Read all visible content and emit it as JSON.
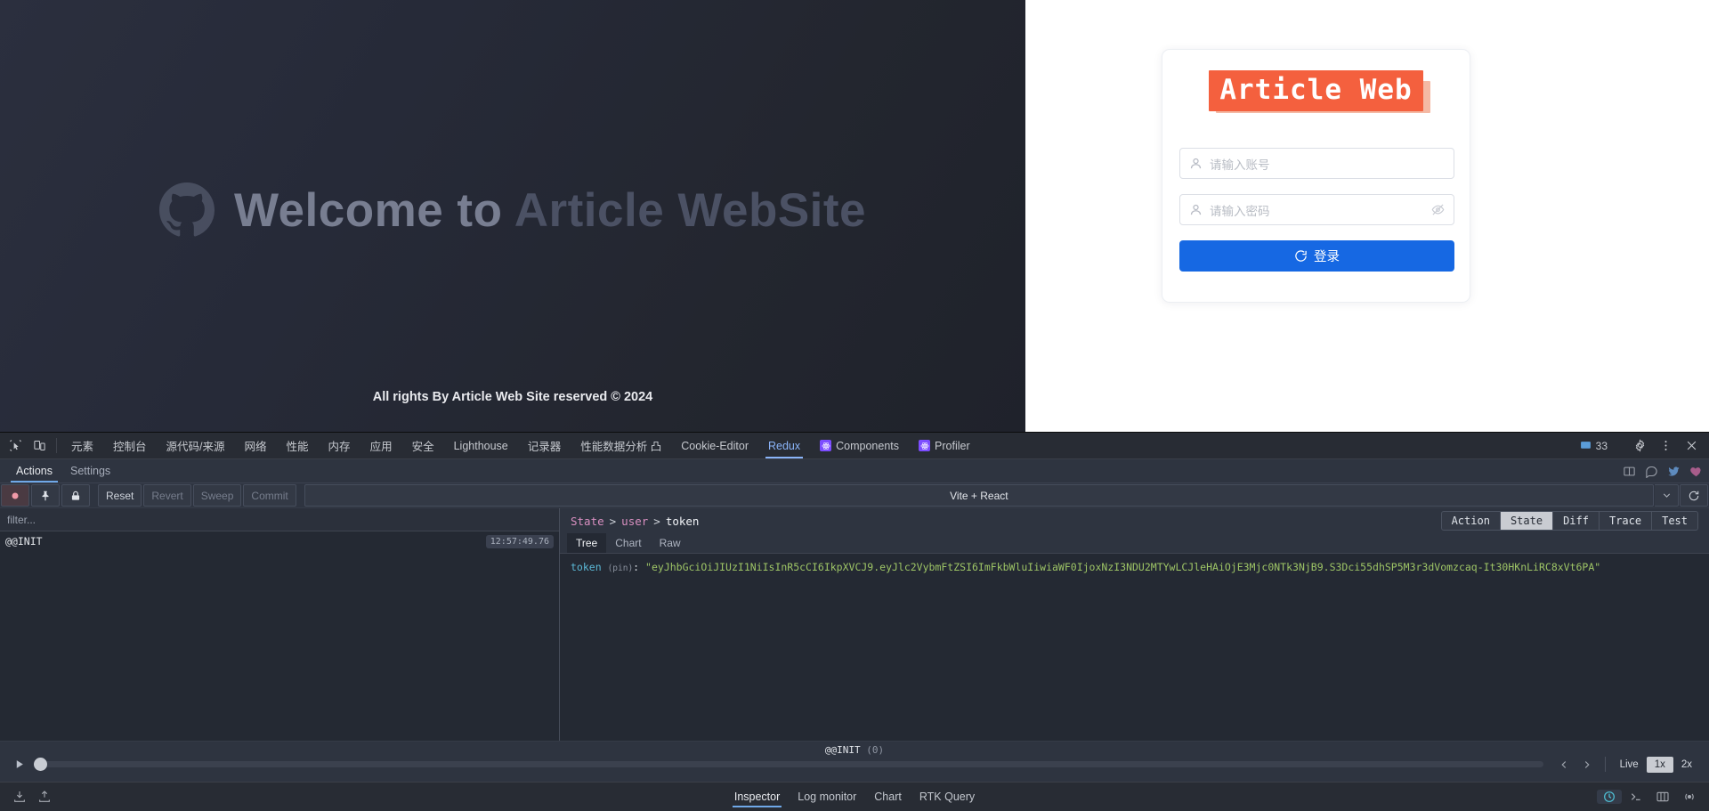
{
  "site": {
    "hero_title_part1": "Welcome to ",
    "hero_title_part2": "Article WebSite",
    "hero_title_full": "Welcome to Article WebSite",
    "github_icon": "github-icon",
    "footer": "All rights By Article Web Site reserved © 2024"
  },
  "login": {
    "brand": "Article Web",
    "username_placeholder": "请输入账号",
    "password_placeholder": "请输入密码",
    "user_icon": "user-icon",
    "eye_icon": "eye-off-icon",
    "submit_label": "登录",
    "submit_icon": "login-icon",
    "accent_color": "#1668e3",
    "brand_color": "#f4603e"
  },
  "devtools": {
    "inspect_icon": "inspect-element-icon",
    "device_icon": "device-toolbar-icon",
    "tabs": [
      {
        "label": "元素",
        "active": false,
        "icon": null
      },
      {
        "label": "控制台",
        "active": false,
        "icon": null
      },
      {
        "label": "源代码/来源",
        "active": false,
        "icon": null
      },
      {
        "label": "网络",
        "active": false,
        "icon": null
      },
      {
        "label": "性能",
        "active": false,
        "icon": null
      },
      {
        "label": "内存",
        "active": false,
        "icon": null
      },
      {
        "label": "应用",
        "active": false,
        "icon": null
      },
      {
        "label": "安全",
        "active": false,
        "icon": null
      },
      {
        "label": "Lighthouse",
        "active": false,
        "icon": null
      },
      {
        "label": "记录器",
        "active": false,
        "icon": null
      },
      {
        "label": "性能数据分析 凸",
        "active": false,
        "icon": null
      },
      {
        "label": "Cookie-Editor",
        "active": false,
        "icon": null
      },
      {
        "label": "Redux",
        "active": true,
        "icon": null
      },
      {
        "label": "Components",
        "active": false,
        "icon": "react-icon"
      },
      {
        "label": "Profiler",
        "active": false,
        "icon": "react-icon"
      }
    ],
    "message_count": "33",
    "message_icon": "console-message-icon",
    "settings_icon": "gear-icon",
    "more_icon": "more-vertical-icon",
    "close_icon": "close-icon"
  },
  "redux": {
    "panel_tabs": [
      {
        "label": "Actions",
        "active": true
      },
      {
        "label": "Settings",
        "active": false
      }
    ],
    "panel_tools": [
      "split-layout-icon",
      "chat-icon",
      "twitter-icon",
      "heart-icon"
    ],
    "toolbar": {
      "record_icon": "record-icon",
      "pin_icon": "pin-icon",
      "lock_icon": "lock-icon",
      "buttons": [
        {
          "label": "Reset",
          "enabled": true
        },
        {
          "label": "Revert",
          "enabled": false
        },
        {
          "label": "Sweep",
          "enabled": false
        },
        {
          "label": "Commit",
          "enabled": false
        }
      ],
      "instance_label": "Vite + React",
      "caret_icon": "chevron-down-icon",
      "refresh_icon": "refresh-icon"
    },
    "filter_placeholder": "filter...",
    "actions": [
      {
        "name": "@@INIT",
        "timestamp": "12:57:49.76"
      }
    ],
    "breadcrumb": [
      {
        "label": "State",
        "link": true
      },
      {
        "label": "user",
        "link": true
      },
      {
        "label": "token",
        "link": false
      }
    ],
    "breadcrumb_sep": ">",
    "inspector_tabs": [
      {
        "label": "Action",
        "active": false
      },
      {
        "label": "State",
        "active": true
      },
      {
        "label": "Diff",
        "active": false
      },
      {
        "label": "Trace",
        "active": false
      },
      {
        "label": "Test",
        "active": false
      }
    ],
    "view_tabs": [
      {
        "label": "Tree",
        "active": true
      },
      {
        "label": "Chart",
        "active": false
      },
      {
        "label": "Raw",
        "active": false
      }
    ],
    "state": {
      "key": "token",
      "key_meta": "(pin)",
      "colon": ":",
      "value": "\"eyJhbGciOiJIUzI1NiIsInR5cCI6IkpXVCJ9.eyJlc2VybmFtZSI6ImFkbWluIiwiaWF0IjoxNzI3NDU2MTYwLCJleHAiOjE3Mjc0NTk3NjB9.S3Dci55dhSP5M3r3dVomzcaq-It30HKnLiRC8xVt6PA\""
    },
    "slider": {
      "play_icon": "play-icon",
      "label": "@@INIT",
      "count": "(0)",
      "prev_icon": "chevron-left-icon",
      "next_icon": "chevron-right-icon",
      "live_label": "Live",
      "speeds": [
        {
          "label": "1x",
          "active": true
        },
        {
          "label": "2x",
          "active": false
        }
      ]
    }
  },
  "statusbar": {
    "left_icons": [
      "import-state-icon",
      "export-state-icon"
    ],
    "tabs": [
      {
        "label": "Inspector",
        "active": true
      },
      {
        "label": "Log monitor",
        "active": false
      },
      {
        "label": "Chart",
        "active": false
      },
      {
        "label": "RTK Query",
        "active": false
      }
    ],
    "right_icons": [
      "dispatcher-icon",
      "console-icon",
      "slider-icon",
      "broadcast-icon"
    ]
  }
}
